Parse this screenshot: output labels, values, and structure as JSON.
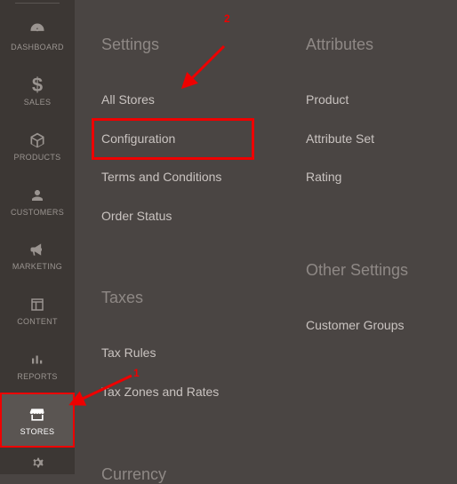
{
  "sidebar": {
    "items": [
      {
        "label": "DASHBOARD",
        "icon": "dashboard"
      },
      {
        "label": "SALES",
        "icon": "dollar"
      },
      {
        "label": "PRODUCTS",
        "icon": "cube"
      },
      {
        "label": "CUSTOMERS",
        "icon": "person"
      },
      {
        "label": "MARKETING",
        "icon": "megaphone"
      },
      {
        "label": "CONTENT",
        "icon": "layout"
      },
      {
        "label": "REPORTS",
        "icon": "bars"
      },
      {
        "label": "STORES",
        "icon": "storefront"
      },
      {
        "label": "",
        "icon": "gear"
      }
    ]
  },
  "columns": {
    "settings": {
      "header": "Settings",
      "items": [
        "All Stores",
        "Configuration",
        "Terms and Conditions",
        "Order Status"
      ]
    },
    "taxes": {
      "header": "Taxes",
      "items": [
        "Tax Rules",
        "Tax Zones and Rates"
      ]
    },
    "currency": {
      "header": "Currency"
    },
    "attributes": {
      "header": "Attributes",
      "items": [
        "Product",
        "Attribute Set",
        "Rating"
      ]
    },
    "other": {
      "header": "Other Settings",
      "items": [
        "Customer Groups"
      ]
    }
  },
  "annotations": {
    "num1": "1",
    "num2": "2"
  },
  "highlight_color": "#ee0000"
}
